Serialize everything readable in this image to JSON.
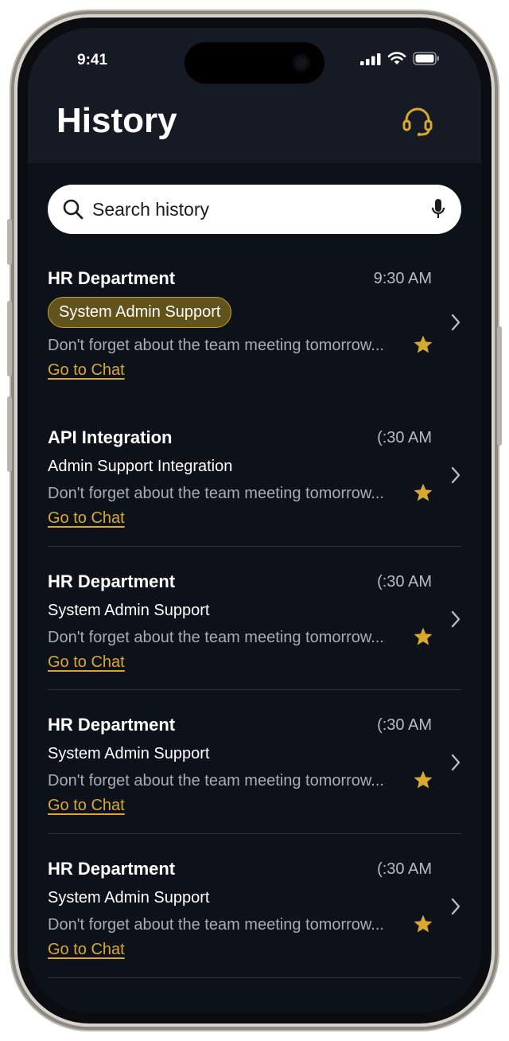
{
  "status_bar": {
    "time": "9:41"
  },
  "header": {
    "title": "History",
    "support_icon": "headset-icon"
  },
  "search": {
    "placeholder": "Search history",
    "value": ""
  },
  "colors": {
    "accent": "#d9a92e",
    "background": "#0d1119",
    "header": "#151a24",
    "pill_bg": "#62521c"
  },
  "chats": [
    {
      "name": "HR Department",
      "time": "9:30 AM",
      "subtitle": "System Admin Support",
      "subtitle_highlighted": true,
      "preview": "Don't forget about the team meeting tomorrow...",
      "starred": true,
      "link": "Go to Chat"
    },
    {
      "name": "API Integration",
      "time": "(:30 AM",
      "subtitle": "Admin Support Integration",
      "subtitle_highlighted": false,
      "preview": "Don't forget about the team meeting tomorrow...",
      "starred": true,
      "link": "Go to Chat"
    },
    {
      "name": "HR Department",
      "time": "(:30 AM",
      "subtitle": "System Admin Support",
      "subtitle_highlighted": false,
      "preview": "Don't forget about the team meeting tomorrow...",
      "starred": true,
      "link": "Go to Chat"
    },
    {
      "name": "HR Department",
      "time": "(:30 AM",
      "subtitle": "System Admin Support",
      "subtitle_highlighted": false,
      "preview": "Don't forget about the team meeting tomorrow...",
      "starred": true,
      "link": "Go to Chat"
    },
    {
      "name": "HR Department",
      "time": "(:30 AM",
      "subtitle": "System Admin Support",
      "subtitle_highlighted": false,
      "preview": "Don't forget about the team meeting tomorrow...",
      "starred": true,
      "link": "Go to Chat"
    }
  ]
}
